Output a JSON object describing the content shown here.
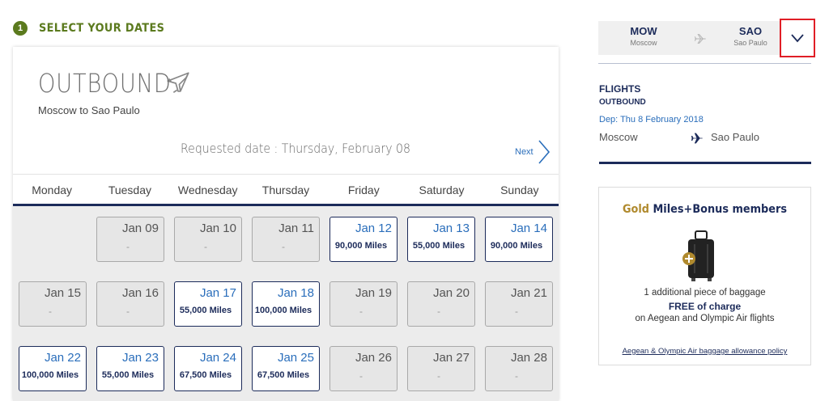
{
  "step": {
    "number": "1",
    "title": "SELECT YOUR DATES"
  },
  "outbound": {
    "title": "OUTBOUND",
    "route": "Moscow to Sao Paulo",
    "requested_date": "Requested date : Thursday, February 08",
    "next_label": "Next"
  },
  "weekdays": [
    "Monday",
    "Tuesday",
    "Wednesday",
    "Thursday",
    "Friday",
    "Saturday",
    "Sunday"
  ],
  "calendar": [
    [
      null,
      {
        "date": "Jan 09",
        "miles": "-",
        "available": false
      },
      {
        "date": "Jan 10",
        "miles": "-",
        "available": false
      },
      {
        "date": "Jan 11",
        "miles": "-",
        "available": false
      },
      {
        "date": "Jan 12",
        "miles": "90,000 Miles",
        "available": true
      },
      {
        "date": "Jan 13",
        "miles": "55,000 Miles",
        "available": true
      },
      {
        "date": "Jan 14",
        "miles": "90,000 Miles",
        "available": true
      }
    ],
    [
      {
        "date": "Jan 15",
        "miles": "-",
        "available": false
      },
      {
        "date": "Jan 16",
        "miles": "-",
        "available": false
      },
      {
        "date": "Jan 17",
        "miles": "55,000 Miles",
        "available": true
      },
      {
        "date": "Jan 18",
        "miles": "100,000 Miles",
        "available": true
      },
      {
        "date": "Jan 19",
        "miles": "-",
        "available": false
      },
      {
        "date": "Jan 20",
        "miles": "-",
        "available": false
      },
      {
        "date": "Jan 21",
        "miles": "-",
        "available": false
      }
    ],
    [
      {
        "date": "Jan 22",
        "miles": "100,000 Miles",
        "available": true
      },
      {
        "date": "Jan 23",
        "miles": "55,000 Miles",
        "available": true
      },
      {
        "date": "Jan 24",
        "miles": "67,500 Miles",
        "available": true
      },
      {
        "date": "Jan 25",
        "miles": "67,500 Miles",
        "available": true
      },
      {
        "date": "Jan 26",
        "miles": "-",
        "available": false
      },
      {
        "date": "Jan 27",
        "miles": "-",
        "available": false
      },
      {
        "date": "Jan 28",
        "miles": "-",
        "available": false
      }
    ]
  ],
  "route_box": {
    "from_code": "MOW",
    "from_city": "Moscow",
    "to_code": "SAO",
    "to_city": "Sao Paulo"
  },
  "flights": {
    "title": "FLIGHTS",
    "direction": "OUTBOUND",
    "departure": "Dep: Thu 8 February 2018",
    "from": "Moscow",
    "to": "Sao Paulo"
  },
  "promo": {
    "title_gold": "Gold",
    "title_rest": " Miles+Bonus members",
    "line1": "1 additional piece of baggage",
    "line2": "FREE of charge",
    "line3": "on Aegean and Olympic Air flights",
    "link": "Aegean & Olympic Air baggage allowance policy"
  },
  "colors": {
    "navy": "#1c2b5a",
    "link_blue": "#2a6ebb",
    "olive": "#5b7a1e",
    "gold": "#b08a2e",
    "highlight_red": "#e01e26"
  },
  "icons": [
    "plane-outline-icon",
    "chevron-right-icon",
    "plane-icon",
    "chevron-down-icon",
    "luggage-icon"
  ]
}
